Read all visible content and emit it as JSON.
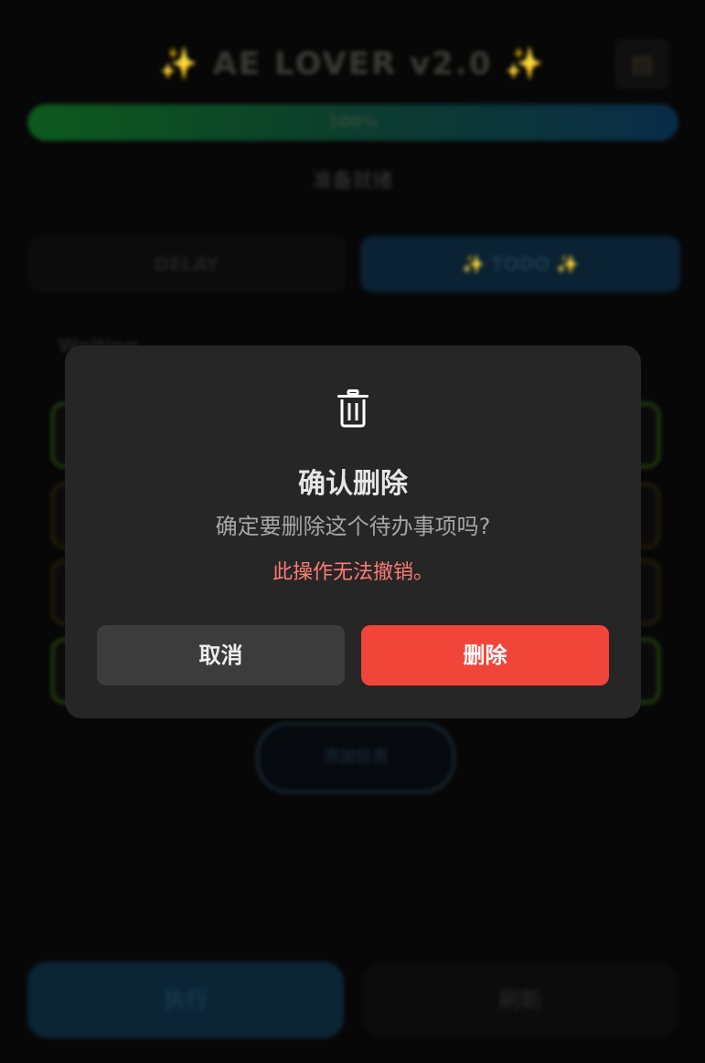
{
  "app": {
    "title_spark": "✨",
    "title": "AE LOVER v2.0",
    "corner_icon": "clipboard-icon",
    "progress_text": "100%",
    "progress_value": 1.0,
    "status_text": "准备就绪",
    "tabs": [
      {
        "label": "DELAY"
      },
      {
        "label": "TODO",
        "active": true
      }
    ],
    "section_label": "Waiting",
    "add_button": "添加任务",
    "run_button": "执行",
    "refresh_button": "刷新"
  },
  "dialog": {
    "icon": "trash-icon",
    "title": "确认删除",
    "message": "确定要删除这个待办事项吗?",
    "warning": "此操作无法撤销。",
    "cancel_label": "取消",
    "delete_label": "删除",
    "colors": {
      "delete": "#f2453a",
      "warning": "#ff7b72",
      "panel": "#262626"
    }
  }
}
